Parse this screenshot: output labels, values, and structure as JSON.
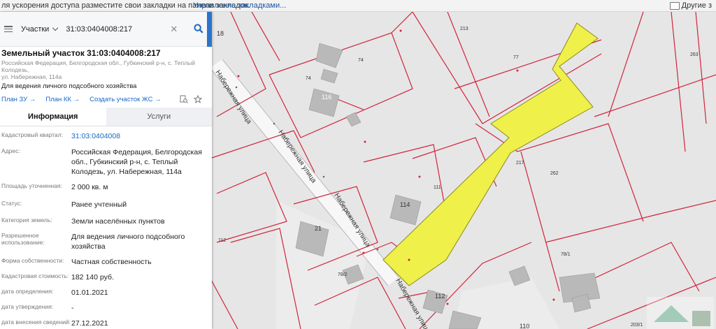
{
  "bookmarks_bar": {
    "text": "ля ускорения доступа разместите свои закладки на панели закладок.",
    "manage_link": "Управление закладками...",
    "other_bookmarks": "Другие з"
  },
  "search": {
    "type_label": "Участки",
    "query": "31:03:0404008:217"
  },
  "parcel": {
    "title": "Земельный участок 31:03:0404008:217",
    "address_line1": "Российская Федерация, Белгородская обл., Губкинский р-н, с. Теплый Колодезь,",
    "address_line2": "ул. Набережная, 114а",
    "purpose": "Для ведения личного подсобного хозяйства"
  },
  "actions": {
    "plan_zu": "План ЗУ",
    "plan_kk": "План КК",
    "create_zhs": "Создать участок ЖС"
  },
  "tabs": {
    "info": "Информация",
    "services": "Услуги"
  },
  "details": [
    {
      "key": "Кадастровый квартал:",
      "value": "31:03:0404008"
    },
    {
      "key": "Адрес:",
      "value": "Российская Федерация, Белгородская обл., Губкинский р-н, с. Теплый Колодезь, ул. Набережная, 114а"
    },
    {
      "key": "Площадь уточненная:",
      "value": "2 000 кв. м"
    },
    {
      "key": "Статус:",
      "value": "Ранее учтенный"
    },
    {
      "key": "Категория земель:",
      "value": "Земли населённых пунктов"
    },
    {
      "key": "Разрешенное использование:",
      "value": "Для ведения личного подсобного хозяйства"
    },
    {
      "key": "Форма собственности:",
      "value": "Частная собственность"
    },
    {
      "key": "Кадастровая стоимость:",
      "value": "182 140 руб."
    },
    {
      "key": "дата определения:",
      "value": "01.01.2021"
    },
    {
      "key": "дата утверждения:",
      "value": "-"
    },
    {
      "key": "дата внесения сведений:",
      "value": "27.12.2021"
    }
  ],
  "map": {
    "street_label": "Набережная улица",
    "lot_labels": [
      "18",
      "213",
      "77",
      "263",
      "74",
      "74",
      "116",
      "217",
      "262",
      "111",
      "114",
      "21",
      "112",
      "78/1",
      "78/2",
      "112",
      "110",
      "203/1"
    ],
    "highlight_color": "#f0f04a"
  }
}
